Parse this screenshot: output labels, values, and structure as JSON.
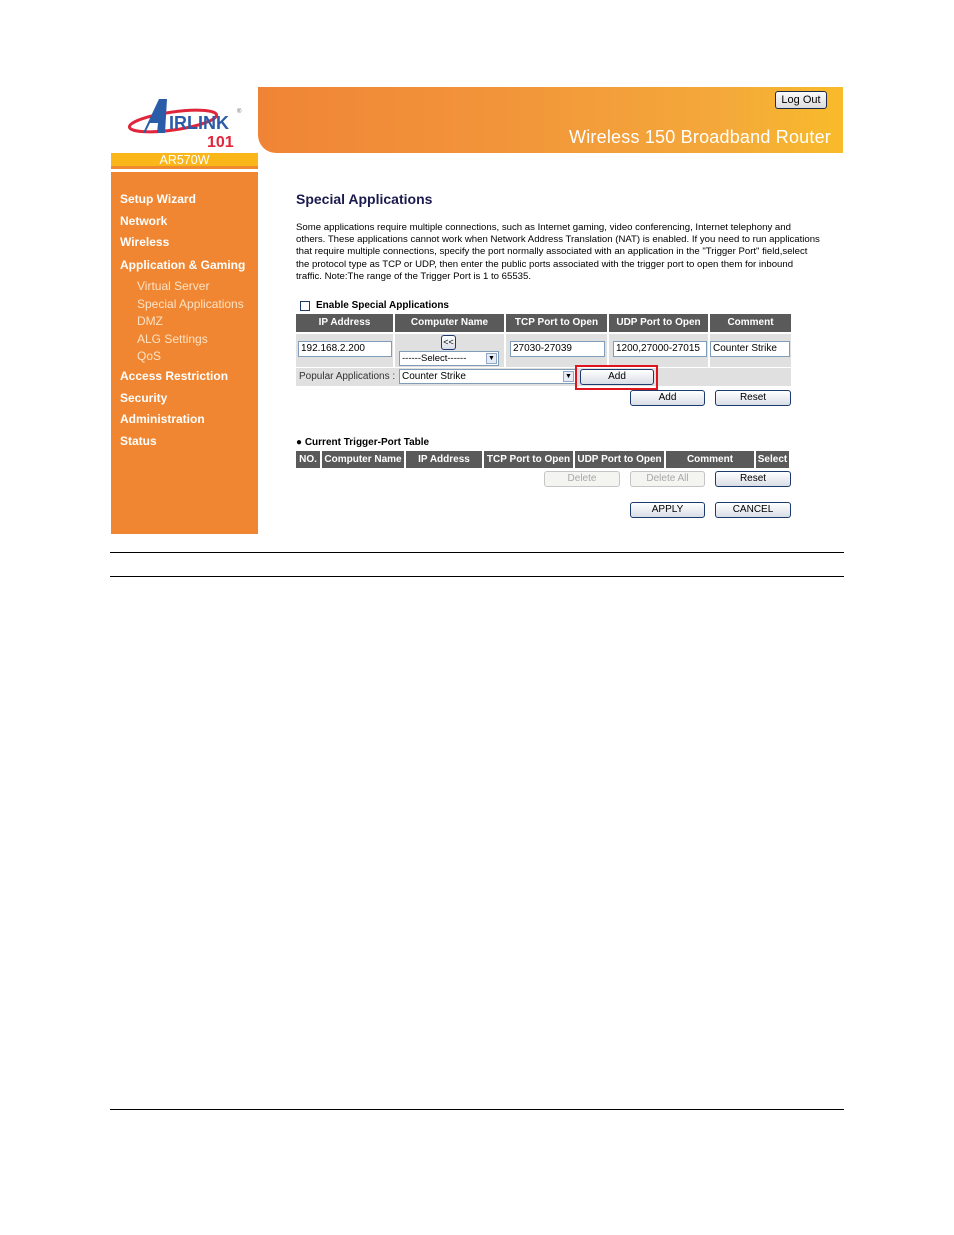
{
  "brand": {
    "logo_text": "AIRLINK",
    "logo_number": "101",
    "model": "AR570W"
  },
  "header": {
    "logout_label": "Log Out",
    "product_title": "Wireless 150 Broadband Router"
  },
  "sidebar": {
    "items": [
      {
        "label": "Setup Wizard",
        "level": "main"
      },
      {
        "label": "Network",
        "level": "main"
      },
      {
        "label": "Wireless",
        "level": "main"
      },
      {
        "label": "Application & Gaming",
        "level": "main"
      },
      {
        "label": "Virtual Server",
        "level": "sub"
      },
      {
        "label": "Special Applications",
        "level": "sub"
      },
      {
        "label": "DMZ",
        "level": "sub"
      },
      {
        "label": "ALG Settings",
        "level": "sub"
      },
      {
        "label": "QoS",
        "level": "sub"
      },
      {
        "label": "Access Restriction",
        "level": "main"
      },
      {
        "label": "Security",
        "level": "main"
      },
      {
        "label": "Administration",
        "level": "main"
      },
      {
        "label": "Status",
        "level": "main"
      }
    ]
  },
  "main": {
    "title": "Special Applications",
    "description": "Some applications require multiple connections, such as Internet gaming, video conferencing, Internet telephony and others. These applications cannot work when Network Address Translation (NAT) is enabled. If you need to run applications that require multiple connections, specify the port normally associated with an application in the \"Trigger Port\" field,select the protocol type as TCP or UDP, then enter the public ports associated with the trigger port to open them for inbound traffic. Note:The range of the Trigger Port is 1 to 65535.",
    "enable_label": "Enable Special Applications",
    "enable_checked": false,
    "form_table": {
      "headers": [
        "IP Address",
        "Computer Name",
        "TCP Port to Open",
        "UDP Port to Open",
        "Comment"
      ],
      "ip_address": "192.168.2.200",
      "copy_button": "<<",
      "computer_select": "------Select------",
      "tcp_ports": "27030-27039",
      "udp_ports": "1200,27000-27015",
      "comment": "Counter Strike"
    },
    "popular": {
      "label": "Popular Applications :",
      "selected": "Counter Strike",
      "add_label": "Add"
    },
    "add_label": "Add",
    "reset_label": "Reset",
    "trigger_table": {
      "title": "Current Trigger-Port Table",
      "headers": [
        "NO.",
        "Computer Name",
        "IP Address",
        "TCP Port to Open",
        "UDP Port to Open",
        "Comment",
        "Select"
      ],
      "rows": []
    },
    "delete_label": "Delete",
    "delete_all_label": "Delete All",
    "reset2_label": "Reset",
    "apply_label": "APPLY",
    "cancel_label": "CANCEL"
  },
  "annotation": {
    "highlight_color": "#e0141e",
    "highlight_target": "popular-add-button"
  },
  "colors": {
    "sidebar": "#f08631",
    "model_bar": "#fbb719",
    "header_start": "#f08436",
    "header_end": "#f8bb2a",
    "table_header": "#5a5a5a",
    "title": "#1a1a4e"
  }
}
